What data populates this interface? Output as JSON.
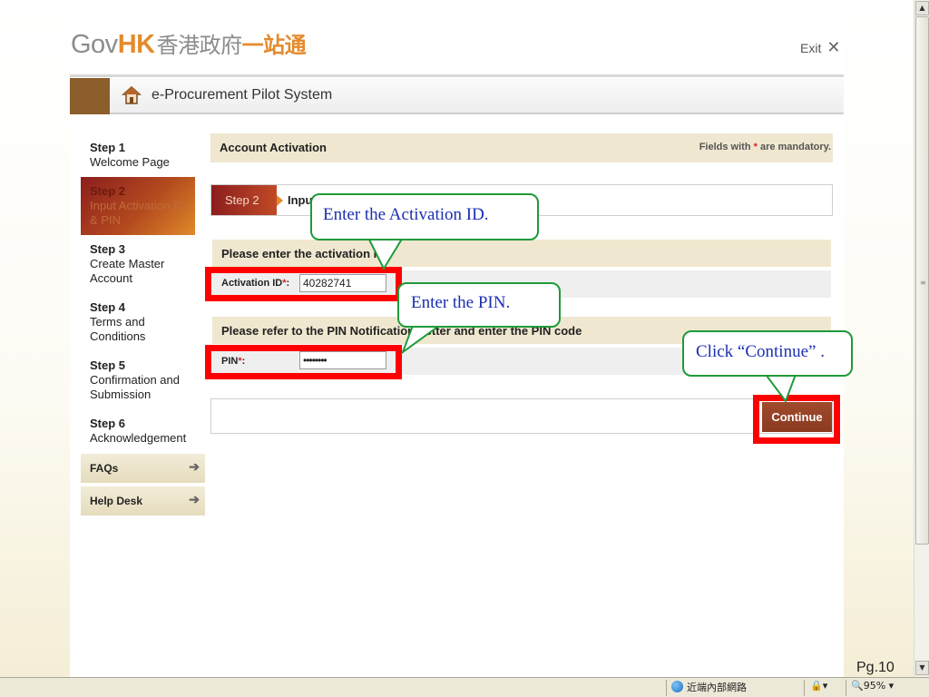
{
  "header": {
    "logo_gov": "Gov",
    "logo_hk": "HK",
    "logo_zh_gov": "香港政府",
    "logo_zh_onestop": "一站通",
    "exit_label": "Exit",
    "exit_icon": "✕",
    "system_title": "e-Procurement Pilot System",
    "home_icon": "house-icon",
    "colors": {
      "brand_orange": "#e48b2d",
      "brand_brown": "#8b5e2b"
    }
  },
  "sidebar": {
    "steps": [
      {
        "num": "Step 1",
        "label": "Welcome Page"
      },
      {
        "num": "Step 2",
        "label": "Input Activation ID & PIN"
      },
      {
        "num": "Step 3",
        "label": "Create Master Account"
      },
      {
        "num": "Step 4",
        "label": "Terms and Conditions"
      },
      {
        "num": "Step 5",
        "label": "Confirmation and Submission"
      },
      {
        "num": "Step 6",
        "label": "Acknowledgement"
      }
    ],
    "links": [
      {
        "label": "FAQs",
        "icon": "arrow-right-icon"
      },
      {
        "label": "Help Desk",
        "icon": "arrow-right-icon"
      }
    ]
  },
  "main": {
    "section_title": "Account Activation",
    "mandatory_prefix": "Fields with ",
    "mandatory_star": "*",
    "mandatory_suffix": " are mandatory.",
    "step_tag": "Step 2",
    "step_title": "Input Activation ID & PIN",
    "activation_heading": "Please enter the activation ID",
    "activation_label": "Activation ID",
    "activation_value": "40282741",
    "pin_heading": "Please refer to the PIN Notification Letter and enter the PIN code",
    "pin_label": "PIN",
    "pin_value": "••••••••",
    "continue_label": "Continue"
  },
  "callouts": {
    "activation": "Enter the Activation ID.",
    "pin": "Enter the PIN.",
    "continue": "Click “Continue” ."
  },
  "page_number": "Pg.10",
  "statusbar": {
    "zone": "近端內部網路",
    "zoom": "95%"
  }
}
